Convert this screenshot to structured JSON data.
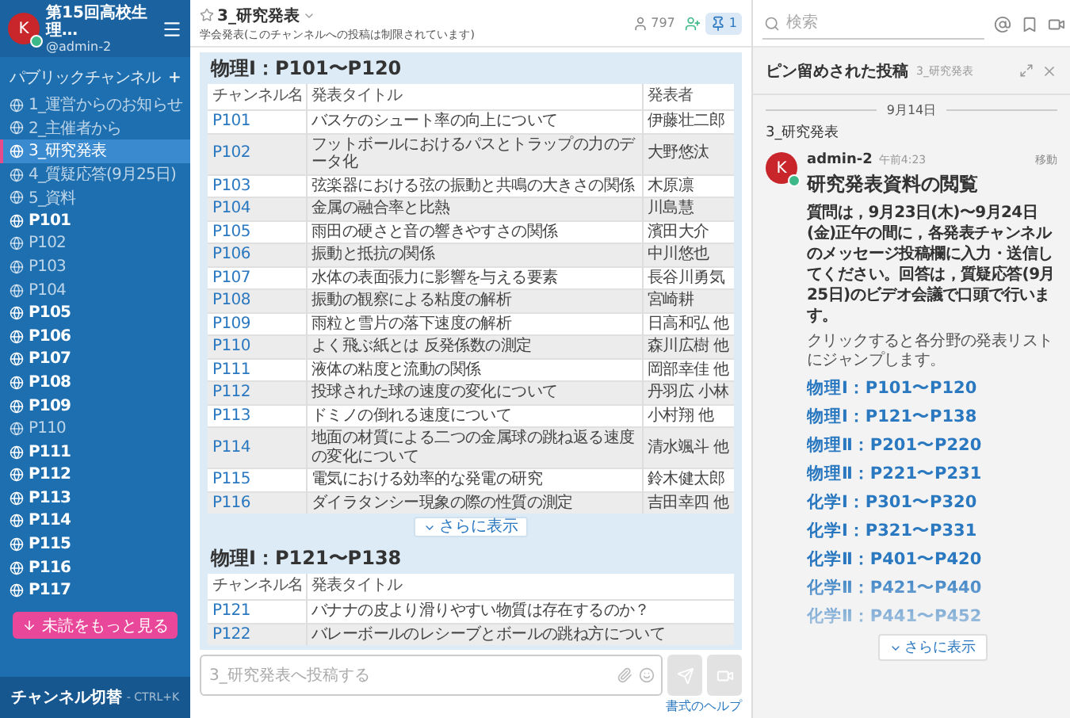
{
  "team": {
    "avatar": "K",
    "name": "第15回高校生理…",
    "user": "@admin-2",
    "online": true
  },
  "sidebar": {
    "section": "パブリックチャンネル",
    "add": "+",
    "channels": [
      {
        "name": "1_運営からのお知らせ",
        "unread": false,
        "selected": false
      },
      {
        "name": "2_主催者から",
        "unread": false,
        "selected": false
      },
      {
        "name": "3_研究発表",
        "unread": false,
        "selected": true
      },
      {
        "name": "4_質疑応答(9月25日)",
        "unread": false,
        "selected": false
      },
      {
        "name": "5_資料",
        "unread": false,
        "selected": false
      },
      {
        "name": "P101",
        "unread": true,
        "selected": false
      },
      {
        "name": "P102",
        "unread": false,
        "selected": false
      },
      {
        "name": "P103",
        "unread": false,
        "selected": false
      },
      {
        "name": "P104",
        "unread": false,
        "selected": false
      },
      {
        "name": "P105",
        "unread": true,
        "selected": false
      },
      {
        "name": "P106",
        "unread": true,
        "selected": false
      },
      {
        "name": "P107",
        "unread": true,
        "selected": false
      },
      {
        "name": "P108",
        "unread": true,
        "selected": false
      },
      {
        "name": "P109",
        "unread": true,
        "selected": false
      },
      {
        "name": "P110",
        "unread": false,
        "selected": false
      },
      {
        "name": "P111",
        "unread": true,
        "selected": false
      },
      {
        "name": "P112",
        "unread": true,
        "selected": false
      },
      {
        "name": "P113",
        "unread": true,
        "selected": false
      },
      {
        "name": "P114",
        "unread": true,
        "selected": false
      },
      {
        "name": "P115",
        "unread": true,
        "selected": false
      },
      {
        "name": "P116",
        "unread": true,
        "selected": false
      },
      {
        "name": "P117",
        "unread": true,
        "selected": false
      }
    ],
    "more_unread": "未読をもっと見る",
    "switcher": "チャンネル切替",
    "shortcut": "- CTRL+K"
  },
  "channel_header": {
    "name": "3_研究発表",
    "topic": "学会発表(このチャンネルへの投稿は制限されています)",
    "members": "797",
    "pinned": "1"
  },
  "tables": [
    {
      "title": "物理Ⅰ：P101〜P120",
      "columns": [
        "チャンネル名",
        "発表タイトル",
        "発表者"
      ],
      "rows": [
        [
          "P101",
          "バスケのシュート率の向上について",
          "伊藤壮二郎"
        ],
        [
          "P102",
          "フットボールにおけるパスとトラップの力のデータ化",
          "大野悠汰"
        ],
        [
          "P103",
          "弦楽器における弦の振動と共鳴の大きさの関係",
          "木原凛"
        ],
        [
          "P104",
          "金属の融合率と比熱",
          "川島慧"
        ],
        [
          "P105",
          "雨田の硬さと音の響きやすさの関係",
          "濱田大介"
        ],
        [
          "P106",
          "振動と抵抗の関係",
          "中川悠也"
        ],
        [
          "P107",
          "水体の表面張力に影響を与える要素",
          "長谷川勇気"
        ],
        [
          "P108",
          "振動の観察による粘度の解析",
          "宮崎耕"
        ],
        [
          "P109",
          "雨粒と雪片の落下速度の解析",
          "日高和弘 他"
        ],
        [
          "P110",
          "よく飛ぶ紙とは 反発係数の測定",
          "森川広樹 他"
        ],
        [
          "P111",
          "液体の粘度と流動の関係",
          "岡部幸佳 他"
        ],
        [
          "P112",
          "投球された球の速度の変化について",
          "丹羽広 小林"
        ],
        [
          "P113",
          "ドミノの倒れる速度について",
          "小村翔 他"
        ],
        [
          "P114",
          "地面の材質による二つの金属球の跳ね返る速度の変化について",
          "清水颯斗 他"
        ],
        [
          "P115",
          "電気における効率的な発電の研究",
          "鈴木健太郎"
        ],
        [
          "P116",
          "ダイラタンシー現象の際の性質の測定",
          "吉田幸四 他"
        ]
      ],
      "more": "さらに表示"
    },
    {
      "title": "物理Ⅰ：P121〜P138",
      "columns": [
        "チャンネル名",
        "発表タイトル"
      ],
      "rows": [
        [
          "P121",
          "バナナの皮より滑りやすい物質は存在するのか？"
        ],
        [
          "P122",
          "バレーボールのレシーブとボールの跳ね方について"
        ]
      ]
    }
  ],
  "composer": {
    "placeholder": "3_研究発表へ投稿する",
    "help": "書式のヘルプ"
  },
  "search": {
    "placeholder": "検索"
  },
  "pinned_panel": {
    "title": "ピン留めされた投稿",
    "channel": "3_研究発表",
    "date": "9月14日",
    "post_channel": "3_研究発表",
    "post": {
      "avatar": "K",
      "author": "admin-2",
      "time": "午前4:23",
      "jump": "移動",
      "heading": "研究発表資料の閲覧",
      "body": "質問は，9月23日(木)〜9月24日(金)正午の間に，各発表チャンネルのメッセージ投稿欄に入力・送信してください。回答は，質疑応答(9月25日)のビデオ会議で口頭で行います。",
      "note": "クリックすると各分野の発表リストにジャンプします。",
      "links": [
        "物理Ⅰ：P101〜P120",
        "物理Ⅰ：P121〜P138",
        "物理Ⅱ：P201〜P220",
        "物理Ⅱ：P221〜P231",
        "化学Ⅰ：P301〜P320",
        "化学Ⅰ：P321〜P331",
        "化学Ⅱ：P401〜P420",
        "化学Ⅱ：P421〜P440",
        "化学Ⅱ：P441〜P452"
      ],
      "more": "さらに表示"
    }
  }
}
